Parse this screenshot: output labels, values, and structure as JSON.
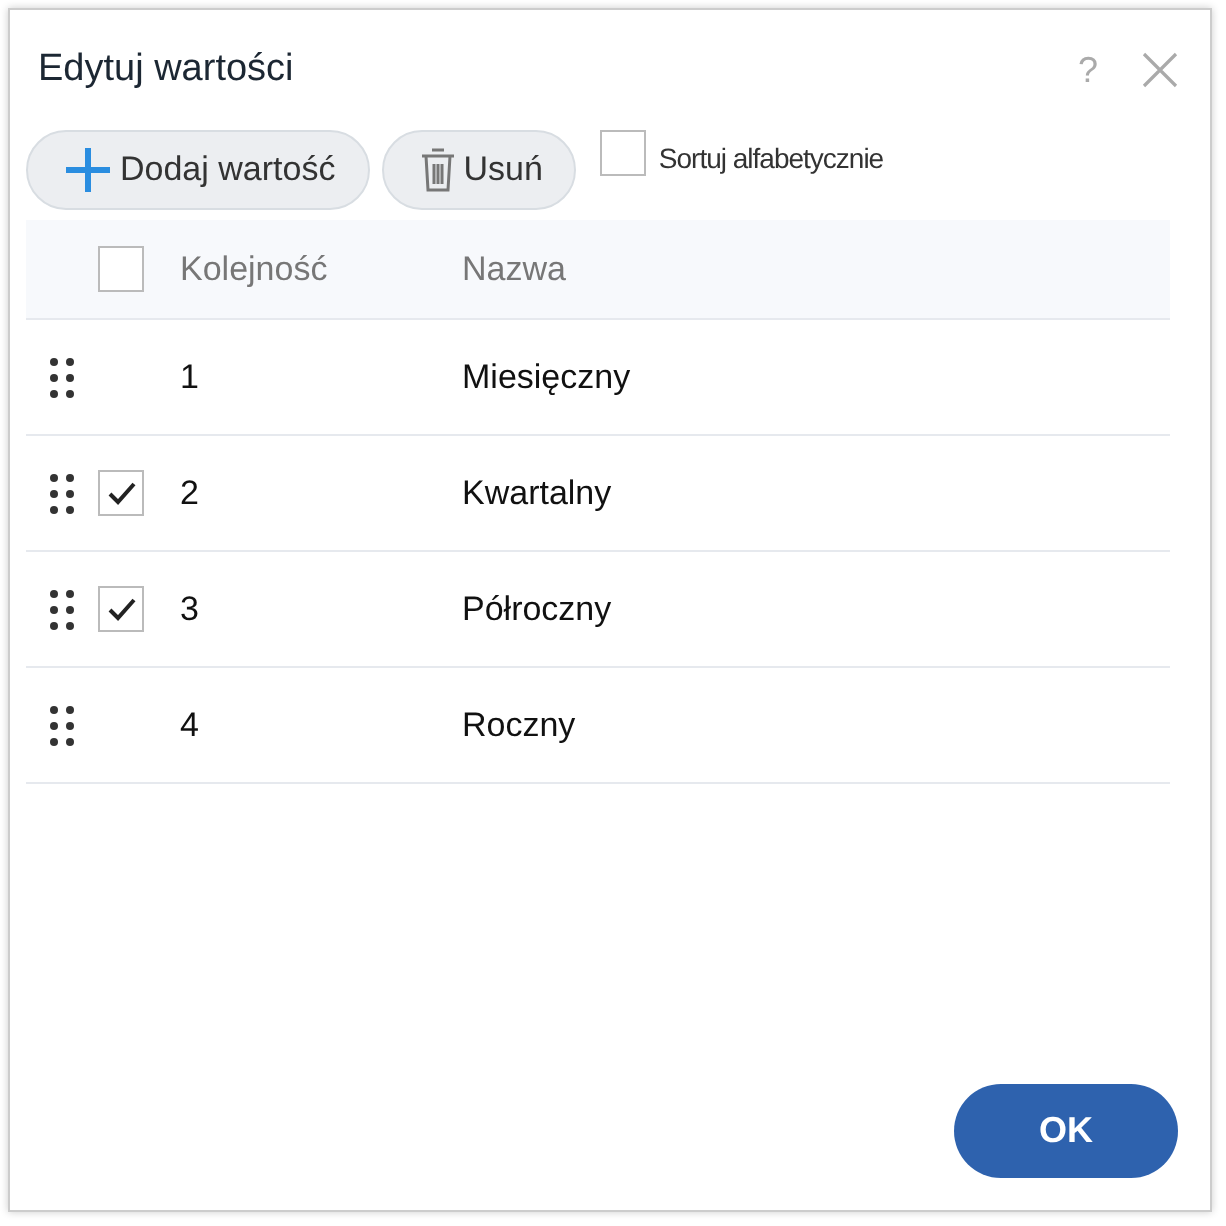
{
  "dialog": {
    "title": "Edytuj wartości",
    "help": "?"
  },
  "toolbar": {
    "add_label": "Dodaj wartość",
    "delete_label": "Usuń",
    "sort_label": "Sortuj alfabetycznie",
    "sort_checked": false
  },
  "table": {
    "header_checked": false,
    "columns": [
      "Kolejność",
      "Nazwa"
    ],
    "rows": [
      {
        "order": "1",
        "name": "Miesięczny",
        "checked": false
      },
      {
        "order": "2",
        "name": "Kwartalny",
        "checked": true
      },
      {
        "order": "3",
        "name": "Półroczny",
        "checked": true
      },
      {
        "order": "4",
        "name": "Roczny",
        "checked": false
      }
    ]
  },
  "buttons": [
    "OK"
  ]
}
